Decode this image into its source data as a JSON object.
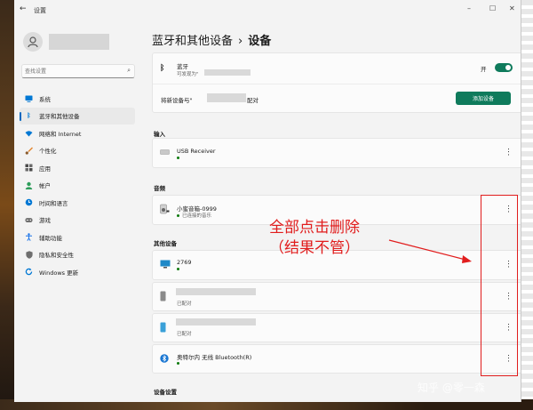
{
  "window": {
    "title": "设置",
    "back_icon": "arrow-left-icon"
  },
  "user": {
    "avatar_icon": "person-icon"
  },
  "search": {
    "placeholder": "查找设置"
  },
  "sidebar": {
    "items": [
      {
        "label": "系统",
        "icon": "monitor-icon",
        "color": "#0078d4"
      },
      {
        "label": "蓝牙和其他设备",
        "icon": "bluetooth-icon",
        "color": "#0078d4",
        "active": true
      },
      {
        "label": "网络和 Internet",
        "icon": "wifi-icon",
        "color": "#0078d4"
      },
      {
        "label": "个性化",
        "icon": "brush-icon",
        "color": "#e3852e"
      },
      {
        "label": "应用",
        "icon": "apps-icon",
        "color": "#4a4a4a"
      },
      {
        "label": "帐户",
        "icon": "account-icon",
        "color": "#2d9d5a"
      },
      {
        "label": "时间和语言",
        "icon": "clock-globe-icon",
        "color": "#0078d4"
      },
      {
        "label": "游戏",
        "icon": "gamepad-icon",
        "color": "#6e6e6e"
      },
      {
        "label": "辅助功能",
        "icon": "accessibility-icon",
        "color": "#1a73e8"
      },
      {
        "label": "隐私和安全性",
        "icon": "shield-icon",
        "color": "#6e6e6e"
      },
      {
        "label": "Windows 更新",
        "icon": "update-icon",
        "color": "#0078d4"
      }
    ]
  },
  "breadcrumb": {
    "parent": "蓝牙和其他设备",
    "separator": "›",
    "current": "设备"
  },
  "bluetooth": {
    "title": "蓝牙",
    "subtitle": "可发现为\"",
    "state_label": "开",
    "accent": "#0f7b5c"
  },
  "pair": {
    "prefix": "将新设备与\"",
    "suffix": "配对",
    "button": "添加设备"
  },
  "sections": {
    "input": "输入",
    "audio": "音频",
    "other": "其他设备",
    "settings": "设备设置"
  },
  "devices": {
    "usb": {
      "name": "USB Receiver"
    },
    "speaker": {
      "name": "小蜜音箱-0999",
      "status": "已连接的音乐"
    },
    "d2769": {
      "name": "2769"
    },
    "phone1": {
      "status": "已配对"
    },
    "phone2": {
      "status": "已配对"
    },
    "bt": {
      "name": "奥特尔内 无线 Bluetooth(R)"
    }
  },
  "annotation": {
    "line1": "全部点击删除",
    "line2": "（结果不管）",
    "color": "#e11d1d"
  },
  "watermark": "知乎 @零一森"
}
